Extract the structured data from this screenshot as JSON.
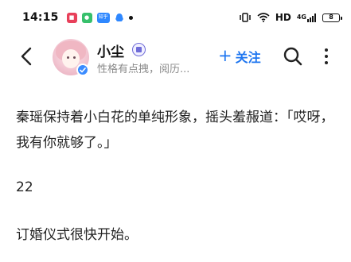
{
  "status_bar": {
    "time": "14:15",
    "app_icons": [
      "red-app-icon",
      "green-chat-app-icon",
      "zhihu-app-icon",
      "qq-app-icon"
    ],
    "zhihu_label": "知乎",
    "network_label": "HD",
    "signal_label": "4G",
    "battery_level": "8"
  },
  "header": {
    "user_name": "小尘",
    "user_bio": "性格有点拽，阅历...",
    "follow_label": "关注",
    "colors": {
      "accent": "#1e76f0",
      "verified": "#3a8bff",
      "badge": "#6f6cd8"
    }
  },
  "content": {
    "paragraph_1": "秦瑶保持着小白花的单纯形象，摇头羞赧道：「哎呀，我有你就够了。」",
    "paragraph_2": "22",
    "paragraph_3": "订婚仪式很快开始。"
  }
}
